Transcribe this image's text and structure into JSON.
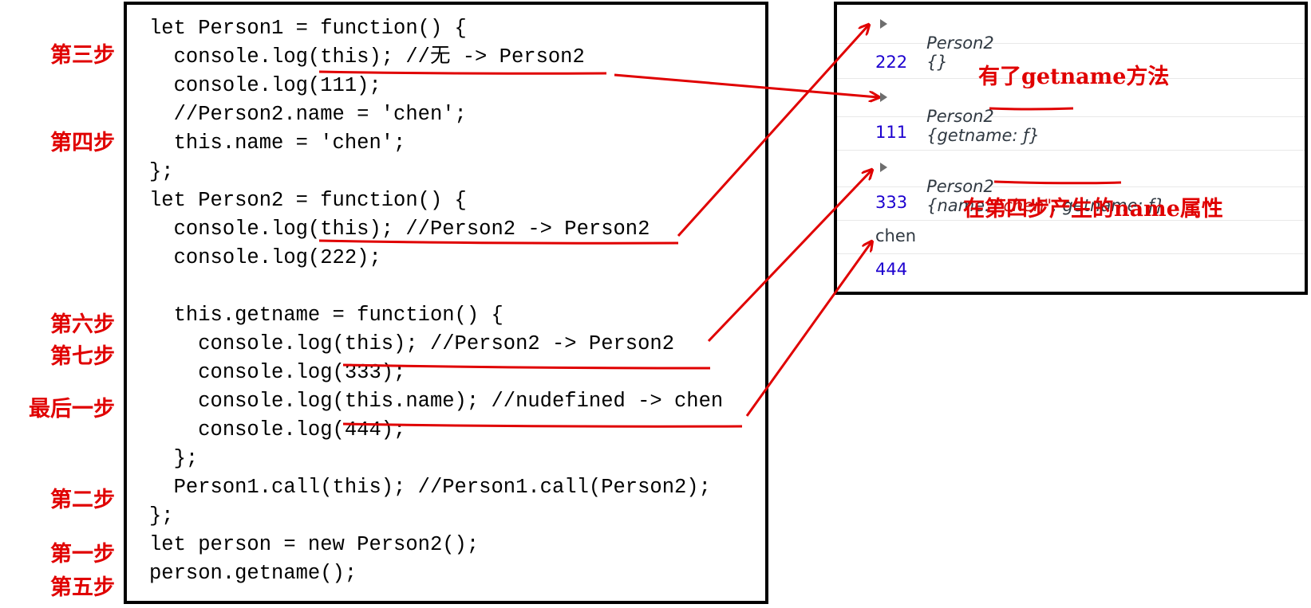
{
  "code_lines": [
    "let Person1 = function() {",
    "  console.log(this); //无 -> Person2",
    "  console.log(111);",
    "  //Person2.name = 'chen';",
    "  this.name = 'chen';",
    "};",
    "let Person2 = function() {",
    "  console.log(this); //Person2 -> Person2",
    "  console.log(222);",
    "",
    "  this.getname = function() {",
    "    console.log(this); //Person2 -> Person2",
    "    console.log(333);",
    "    console.log(this.name); //nudefined -> chen",
    "    console.log(444);",
    "  };",
    "  Person1.call(this); //Person1.call(Person2);",
    "};",
    "let person = new Person2();",
    "person.getname();"
  ],
  "step_labels": {
    "step3": "第三步",
    "step4": "第四步",
    "step6": "第六步",
    "step7": "第七步",
    "step_last": "最后一步",
    "step2": "第二步",
    "step1": "第一步",
    "step5": "第五步"
  },
  "console": {
    "row1_class": "Person2",
    "row1_body": "{}",
    "row2": "222",
    "row3_class": "Person2",
    "row3_open": "{",
    "row3_key": "getname",
    "row3_rest": ": ƒ}",
    "row4": "111",
    "row5_class": "Person2",
    "row5_open": "{",
    "row5_key1": "name",
    "row5_colon": ": ",
    "row5_val": "\"chen\"",
    "row5_rest": ", getname: ƒ}",
    "row6": "333",
    "row7": "chen",
    "row8": "444"
  },
  "annotations": {
    "getname_added": "有了getname方法",
    "name_from_step4": "在第四步产生的name属性"
  },
  "colors": {
    "annotation_red": "#e00000",
    "console_number": "#1c00cf",
    "console_string": "#c41a16"
  }
}
